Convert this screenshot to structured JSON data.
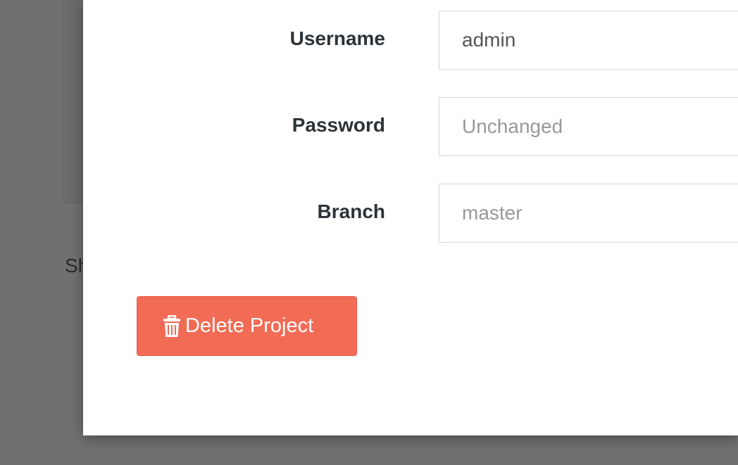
{
  "background": {
    "partial_text": "Sh"
  },
  "form": {
    "username": {
      "label": "Username",
      "value": "admin",
      "placeholder": ""
    },
    "password": {
      "label": "Password",
      "value": "",
      "placeholder": "Unchanged"
    },
    "branch": {
      "label": "Branch",
      "value": "",
      "placeholder": "master"
    }
  },
  "actions": {
    "delete_label": "Delete Project",
    "delete_icon": "trash-icon",
    "delete_color": "#f26b55"
  }
}
